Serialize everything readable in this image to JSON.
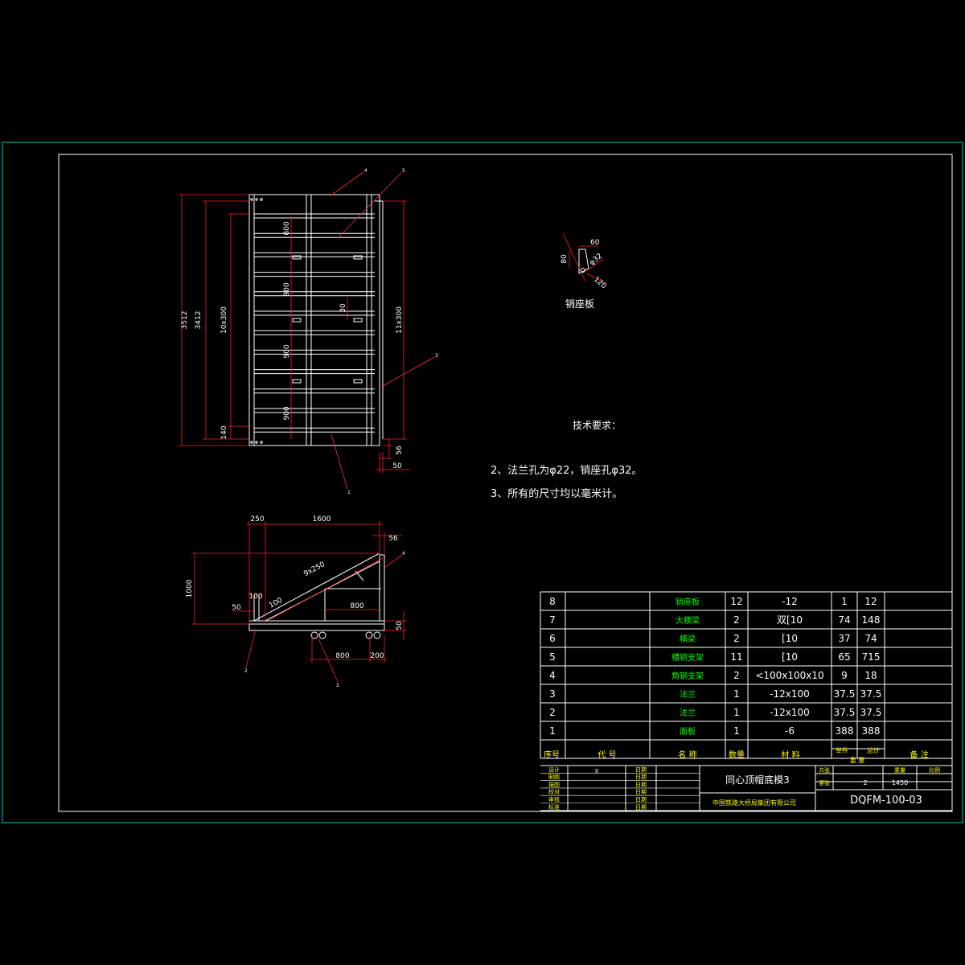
{
  "colors": {
    "background": "#000000",
    "outer_border": "#00c8c8",
    "geometry": "#ffffff",
    "dimension": "#ff2020",
    "leader": "#ff3030",
    "table_line": "#ffffff",
    "table_text": "#ffffff",
    "table_header": "#ffff00",
    "table_name": "#00ff00"
  },
  "plan_view": {
    "dims_left": [
      "3512",
      "3412",
      "10x300",
      "140"
    ],
    "dims_inner": [
      "600",
      "900",
      "900",
      "900"
    ],
    "dim_center": "30",
    "dims_right": [
      "11x300",
      "56",
      "50"
    ],
    "balloons": [
      "4",
      "5",
      "3",
      "1"
    ]
  },
  "pin_plate": {
    "dims": [
      "60",
      "80",
      "φ32",
      "120"
    ],
    "title": "销座板"
  },
  "notes": {
    "heading": "技术要求：",
    "lines": [
      "2、法兰孔为φ22，销座孔φ32。",
      "3、所有的尺寸均以毫米计。"
    ]
  },
  "side_view": {
    "dims_top": [
      "250",
      "1600",
      "56"
    ],
    "dim_left": "1000",
    "dims_small": [
      "50",
      "100",
      "100"
    ],
    "dim_diag": "9x250",
    "dim_inner": "800",
    "dims_bottom": [
      "800",
      "200"
    ],
    "dim_right": "50",
    "balloons": [
      "4",
      "2",
      "2"
    ]
  },
  "bom": {
    "rows": [
      {
        "no": "8",
        "code": "",
        "name": "销座板",
        "qty": "12",
        "material": "-12",
        "unit": "1",
        "total": "12",
        "note": ""
      },
      {
        "no": "7",
        "code": "",
        "name": "大横梁",
        "qty": "2",
        "material": "双[10",
        "unit": "74",
        "total": "148",
        "note": ""
      },
      {
        "no": "6",
        "code": "",
        "name": "横梁",
        "qty": "2",
        "material": "[10",
        "unit": "37",
        "total": "74",
        "note": ""
      },
      {
        "no": "5",
        "code": "",
        "name": "槽钢支架",
        "qty": "11",
        "material": "[10",
        "unit": "65",
        "total": "715",
        "note": ""
      },
      {
        "no": "4",
        "code": "",
        "name": "角钢支架",
        "qty": "2",
        "material": "<100x100x10",
        "unit": "9",
        "total": "18",
        "note": ""
      },
      {
        "no": "3",
        "code": "",
        "name": "法兰",
        "qty": "1",
        "material": "-12x100",
        "unit": "37.5",
        "total": "37.5",
        "note": ""
      },
      {
        "no": "2",
        "code": "",
        "name": "法兰",
        "qty": "1",
        "material": "-12x100",
        "unit": "37.5",
        "total": "37.5",
        "note": ""
      },
      {
        "no": "1",
        "code": "",
        "name": "面板",
        "qty": "1",
        "material": "-6",
        "unit": "388",
        "total": "388",
        "note": ""
      }
    ],
    "header": {
      "no": "序号",
      "code": "代  号",
      "name": "名  称",
      "qty": "数量",
      "material": "材  料",
      "unit": "单件",
      "total": "总计",
      "weight": "重  量",
      "note": "备  注"
    }
  },
  "title_block": {
    "sign_labels": [
      "设计",
      "制图",
      "描图",
      "校对",
      "审核",
      "标准"
    ],
    "date_label": "日期",
    "x_mark": "X",
    "drawing_name": "同心顶帽底模3",
    "company": "中国铁路大桥局集团有限公司",
    "sheet_labels": [
      "共张",
      "第张",
      "重量",
      "比例"
    ],
    "sheet_values": [
      "2",
      "1450"
    ],
    "drawing_number": "DQFM-100-03"
  }
}
